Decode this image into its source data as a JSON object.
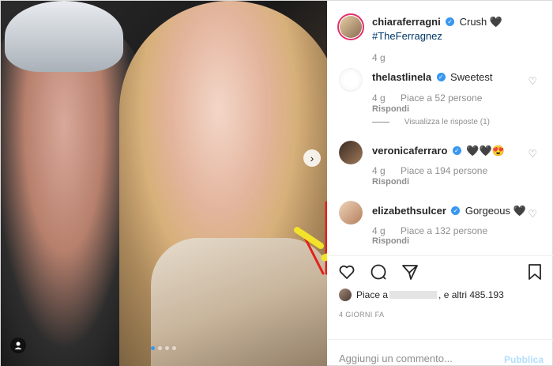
{
  "post": {
    "photo": {
      "next_icon": "chevron-right-icon",
      "user_icon": "user-tag-icon",
      "carousel_count": 4,
      "carousel_active": 0
    },
    "caption": {
      "username": "chiaraferragni",
      "text": "Crush 🖤",
      "hashtag": "#TheFerragnez",
      "age": "4 g"
    },
    "comments": [
      {
        "username": "thelastlinela",
        "text": "Sweetest",
        "age": "4 g",
        "likes": "Piace a 52 persone",
        "reply": "Rispondi",
        "view_replies": "Visualizza le risposte (1)"
      },
      {
        "username": "veronicaferraro",
        "text": "🖤🖤😍",
        "age": "4 g",
        "likes": "Piace a 194 persone",
        "reply": "Rispondi"
      },
      {
        "username": "elizabethsulcer",
        "text": "Gorgeous 🖤",
        "age": "4 g",
        "likes": "Piace a 132 persone",
        "reply": "Rispondi"
      }
    ],
    "likes_prefix": "Piace a",
    "likes_suffix": ", e altri 485.193",
    "timestamp": "4 GIORNI FA",
    "comment_placeholder": "Aggiungi un commento...",
    "publish_label": "Pubblica"
  },
  "colors": {
    "accent": "#3897f0",
    "publish_disabled": "#b2dffc",
    "muted": "#8e8e8e"
  }
}
